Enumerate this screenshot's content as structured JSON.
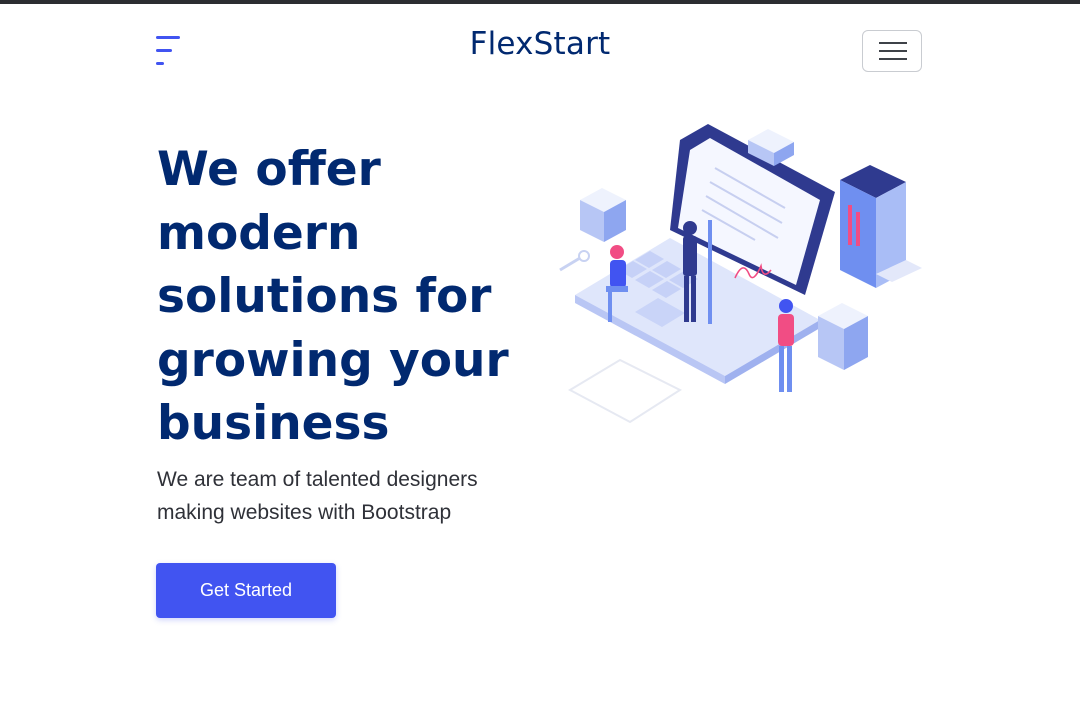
{
  "header": {
    "brand_name": "FlexStart",
    "logo_icon": "flexstart-logo-icon",
    "menu_icon": "hamburger-menu-icon"
  },
  "hero": {
    "title": "We offer modern solutions for growing your business",
    "subtitle": "We are team of talented designers making websites with Bootstrap",
    "cta_label": "Get Started",
    "illustration": "isometric-laptop-team-illustration"
  },
  "colors": {
    "primary": "#4154f1",
    "heading": "#012970",
    "text": "#2f3138",
    "illustration_blue": "#6f8ff0",
    "illustration_pink": "#f14d84"
  }
}
